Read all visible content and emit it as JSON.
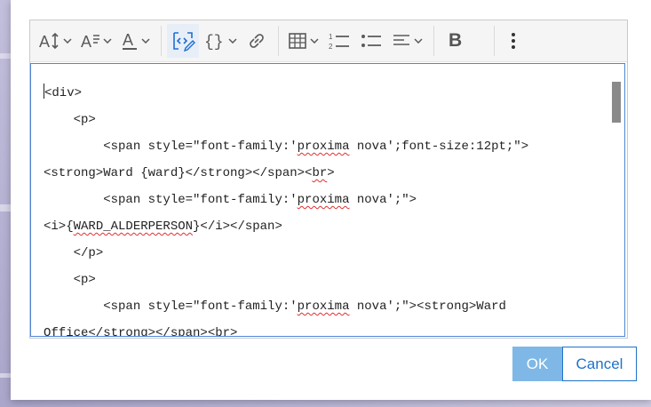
{
  "toolbar": {
    "buttons": [
      {
        "name": "font-size",
        "icon": "font-size-icon"
      },
      {
        "name": "paragraph-format",
        "icon": "paragraph-format-icon"
      },
      {
        "name": "font-color",
        "icon": "font-color-icon"
      },
      {
        "name": "source-code",
        "icon": "source-code-icon",
        "active": true
      },
      {
        "name": "insert-expression",
        "icon": "curly-braces-icon"
      },
      {
        "name": "insert-link",
        "icon": "link-icon"
      },
      {
        "name": "insert-table",
        "icon": "table-icon"
      },
      {
        "name": "numbered-list",
        "icon": "numbered-list-icon"
      },
      {
        "name": "bulleted-list",
        "icon": "bulleted-list-icon"
      },
      {
        "name": "align",
        "icon": "align-left-icon"
      },
      {
        "name": "more",
        "icon": "more-vertical-icon"
      }
    ],
    "bold_label": "B",
    "active_color": "#1f6fcf"
  },
  "code": {
    "lines": [
      {
        "indent": "",
        "parts": [
          {
            "t": "<div>"
          }
        ]
      },
      {
        "indent": "    ",
        "parts": [
          {
            "t": "<p>"
          }
        ]
      },
      {
        "indent": "        ",
        "parts": [
          {
            "t": "<span style=\"font-family:'"
          },
          {
            "t": "proxima",
            "spell": true
          },
          {
            "t": " nova';font-size:12pt;\">"
          }
        ]
      },
      {
        "indent": "",
        "parts": [
          {
            "t": "<strong>Ward {ward}</strong></span><"
          },
          {
            "t": "br",
            "spell": true
          },
          {
            "t": ">"
          }
        ]
      },
      {
        "indent": "        ",
        "parts": [
          {
            "t": "<span style=\"font-family:'"
          },
          {
            "t": "proxima",
            "spell": true
          },
          {
            "t": " nova';\">"
          }
        ]
      },
      {
        "indent": "",
        "parts": [
          {
            "t": "<i>{"
          },
          {
            "t": "WARD_ALDERPERSON",
            "spell": true
          },
          {
            "t": "}</i></span>"
          }
        ]
      },
      {
        "indent": "    ",
        "parts": [
          {
            "t": "</p>"
          }
        ]
      },
      {
        "indent": "    ",
        "parts": [
          {
            "t": "<p>"
          }
        ]
      },
      {
        "indent": "        ",
        "parts": [
          {
            "t": "<span style=\"font-family:'"
          },
          {
            "t": "proxima",
            "spell": true
          },
          {
            "t": " nova';\"><strong>Ward"
          }
        ]
      },
      {
        "indent": "",
        "parts": [
          {
            "t": "Office</strong></span><"
          },
          {
            "t": "br",
            "spell": true
          },
          {
            "t": ">"
          }
        ]
      }
    ]
  },
  "footer": {
    "ok_label": "OK",
    "cancel_label": "Cancel",
    "ok_color": "#7fb8e6",
    "cancel_color": "#1f72c9"
  }
}
